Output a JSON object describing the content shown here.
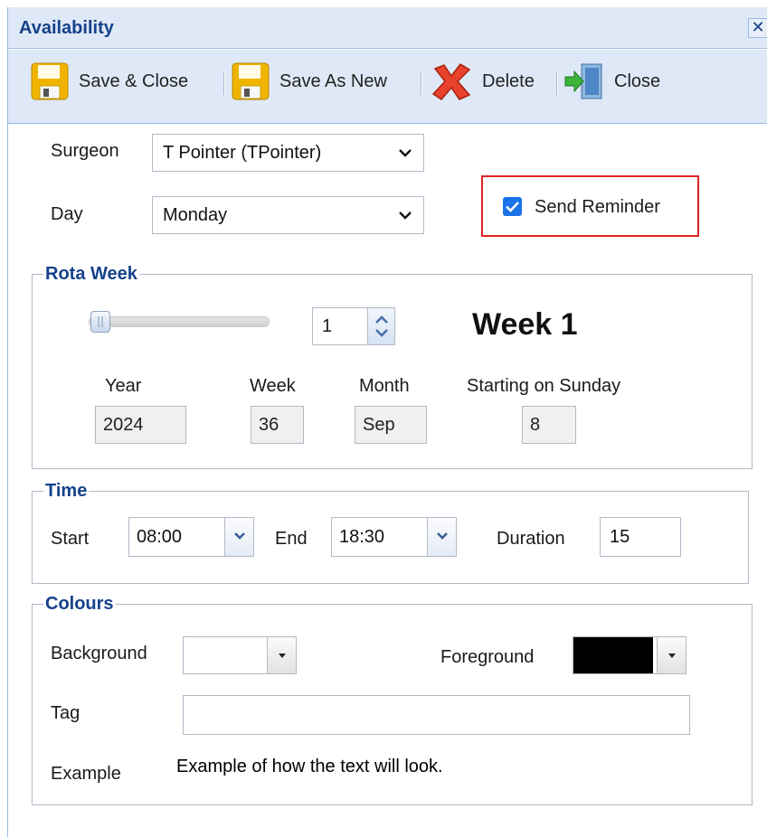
{
  "window": {
    "title": "Availability",
    "close_glyph": "✕"
  },
  "toolbar": {
    "save_close": "Save & Close",
    "save_as_new": "Save As New",
    "delete": "Delete",
    "close": "Close"
  },
  "form": {
    "surgeon_label": "Surgeon",
    "surgeon_value": "T Pointer (TPointer)",
    "day_label": "Day",
    "day_value": "Monday",
    "send_reminder_label": "Send Reminder",
    "send_reminder_checked": true
  },
  "rota_week": {
    "legend": "Rota Week",
    "slider_value": 1,
    "spinner_value": "1",
    "week_heading": "Week 1",
    "year_label": "Year",
    "year_value": "2024",
    "week_label": "Week",
    "week_value": "36",
    "month_label": "Month",
    "month_value": "Sep",
    "starting_label": "Starting on Sunday",
    "starting_value": "8"
  },
  "time": {
    "legend": "Time",
    "start_label": "Start",
    "start_value": "08:00",
    "end_label": "End",
    "end_value": "18:30",
    "duration_label": "Duration",
    "duration_value": "15"
  },
  "colours": {
    "legend": "Colours",
    "background_label": "Background",
    "background_color": "#ffffff",
    "foreground_label": "Foreground",
    "foreground_color": "#000000",
    "tag_label": "Tag",
    "tag_value": "",
    "example_label": "Example",
    "example_text": "Example of how the text will look."
  },
  "icons": {
    "save_close": "floppy-disk-icon",
    "save_as_new": "floppy-disk-icon",
    "delete": "red-x-icon",
    "close": "exit-door-icon"
  },
  "accent": "#15428b",
  "highlight": "#e02424"
}
